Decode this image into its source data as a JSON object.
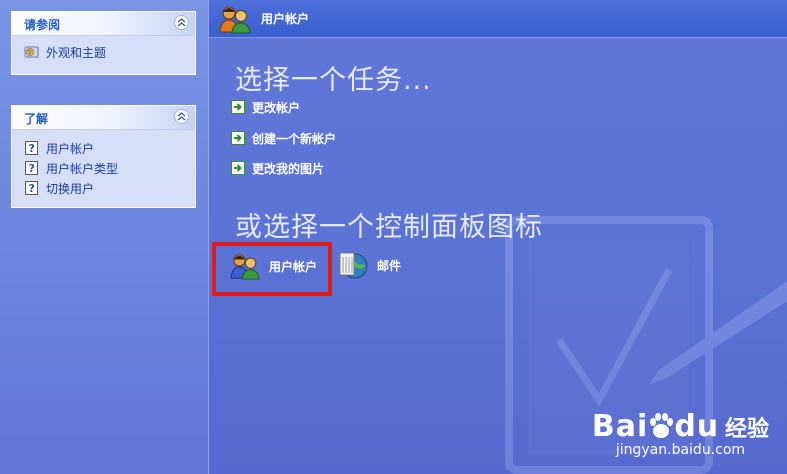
{
  "sidebar": {
    "see_also": {
      "title": "请参阅",
      "items": [
        {
          "label": "外观和主题",
          "icon": "appearance-icon"
        }
      ]
    },
    "learn_about": {
      "title": "了解",
      "items": [
        {
          "label": "用户帐户",
          "icon": "help-icon"
        },
        {
          "label": "用户帐户类型",
          "icon": "help-icon"
        },
        {
          "label": "切换用户",
          "icon": "help-icon"
        }
      ]
    }
  },
  "header": {
    "title": "用户帐户",
    "icon": "user-accounts-icon"
  },
  "main": {
    "pick_task_heading": "选择一个任务...",
    "tasks": [
      {
        "label": "更改帐户"
      },
      {
        "label": "创建一个新帐户"
      },
      {
        "label": "更改我的图片"
      }
    ],
    "pick_icon_heading": "或选择一个控制面板图标",
    "control_panel_icons": [
      {
        "label": "用户帐户",
        "icon": "user-accounts-icon"
      },
      {
        "label": "邮件",
        "icon": "mail-icon"
      }
    ]
  },
  "watermark": {
    "brand_prefix": "Bai",
    "brand_suffix": "du",
    "jingyan": "经验",
    "url": "jingyan.baidu.com"
  },
  "colors": {
    "highlight_box": "#e01b1b",
    "pane_blue": "#5a71d4",
    "link_blue": "#215dc6"
  }
}
